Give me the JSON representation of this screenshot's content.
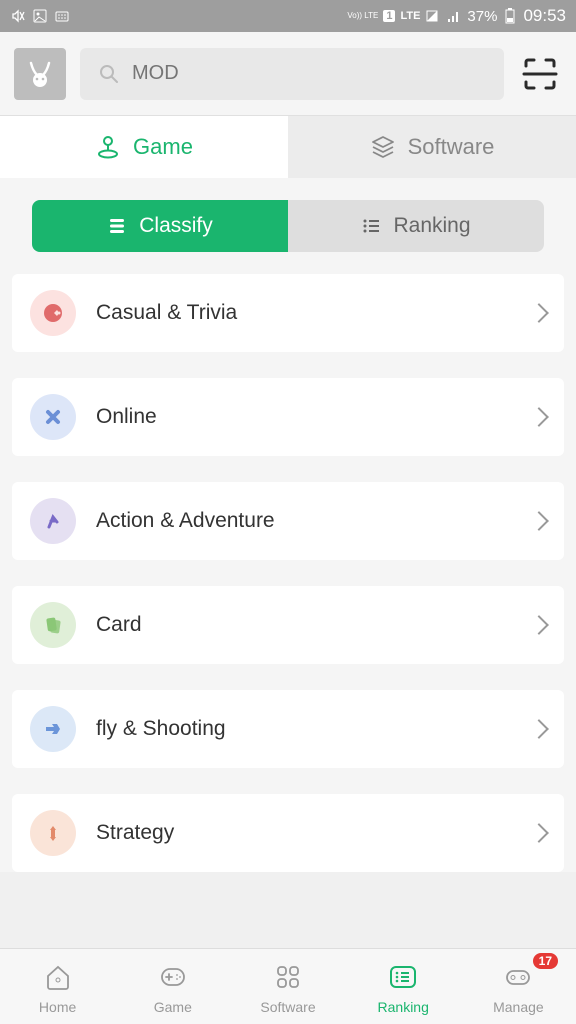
{
  "status": {
    "battery": "37%",
    "time": "09:53",
    "lte": "LTE",
    "sim": "1",
    "volte": "Vo))\nLTE"
  },
  "search": {
    "placeholder": "MOD"
  },
  "tabs": {
    "game": "Game",
    "software": "Software"
  },
  "subtabs": {
    "classify": "Classify",
    "ranking": "Ranking"
  },
  "categories": [
    {
      "label": "Casual & Trivia",
      "iconClass": "ic-pink",
      "iconColor": "#e06b6b"
    },
    {
      "label": "Online",
      "iconClass": "ic-blue",
      "iconColor": "#6b8fd6"
    },
    {
      "label": "Action & Adventure",
      "iconClass": "ic-purple",
      "iconColor": "#7a6bc7"
    },
    {
      "label": "Card",
      "iconClass": "ic-green",
      "iconColor": "#8bc777"
    },
    {
      "label": "fly & Shooting",
      "iconClass": "ic-lblue",
      "iconColor": "#6b95d9"
    },
    {
      "label": "Strategy",
      "iconClass": "ic-orange",
      "iconColor": "#e28a6a"
    }
  ],
  "nav": {
    "home": "Home",
    "game": "Game",
    "software": "Software",
    "ranking": "Ranking",
    "manage": "Manage",
    "badge": "17"
  }
}
